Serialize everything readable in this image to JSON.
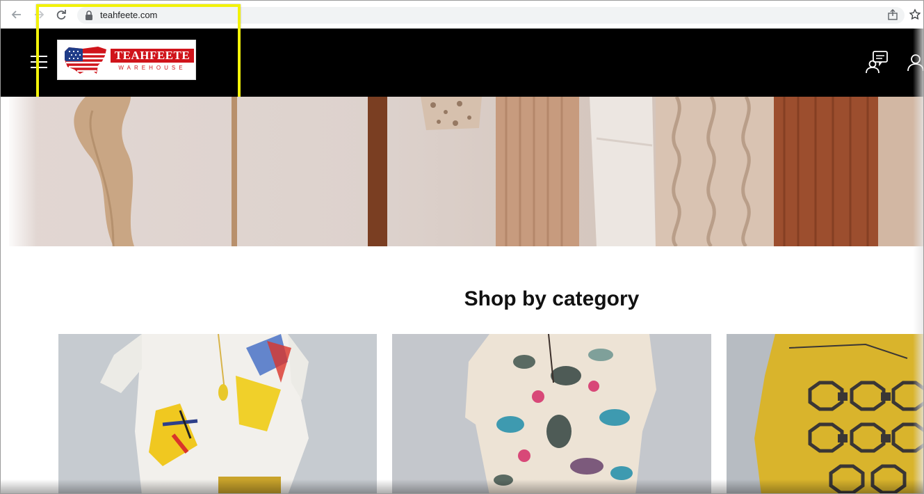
{
  "browser": {
    "url": "teahfeete.com",
    "back_icon": "back-arrow-icon",
    "forward_icon": "forward-arrow-icon",
    "reload_icon": "reload-icon",
    "lock_icon": "lock-icon",
    "share_icon": "share-icon",
    "bookmark_icon": "star-icon"
  },
  "header": {
    "background": "#000000",
    "menu_icon": "hamburger-menu-icon",
    "logo": {
      "title": "TEAHFEETE",
      "subtitle": "WAREHOUSE",
      "brand_color": "#d0141b"
    },
    "chat_icon": "chat-support-icon",
    "account_icon": "user-icon"
  },
  "annotation": {
    "color": "#f2f20a"
  },
  "main": {
    "section_title": "Shop by category",
    "categories": [
      {
        "image": "white linen blouse with abstract ink print"
      },
      {
        "image": "cream floral print tunic"
      },
      {
        "image": "yellow geometric print top"
      }
    ]
  }
}
